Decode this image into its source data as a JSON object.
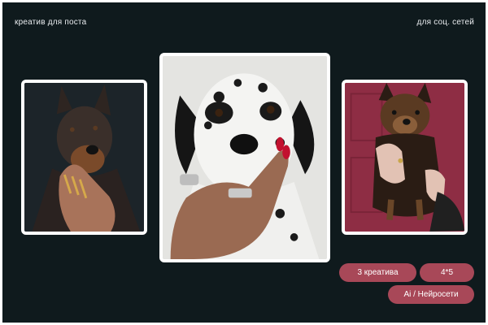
{
  "header": {
    "left_text": "креатив для поста",
    "right_text": "для соц. сетей"
  },
  "images": {
    "left": "doberman-photo",
    "center": "dalmatian-photo",
    "right": "yorkshire-terrier-photo"
  },
  "tags": {
    "count_label": "3 креатива",
    "ratio_label": "4*5",
    "ai_label": "Ai / Нейросети"
  },
  "colors": {
    "background": "#0f1a1d",
    "pill": "#a84858",
    "frame": "#ffffff",
    "right_photo_backdrop": "#8c2b41"
  }
}
